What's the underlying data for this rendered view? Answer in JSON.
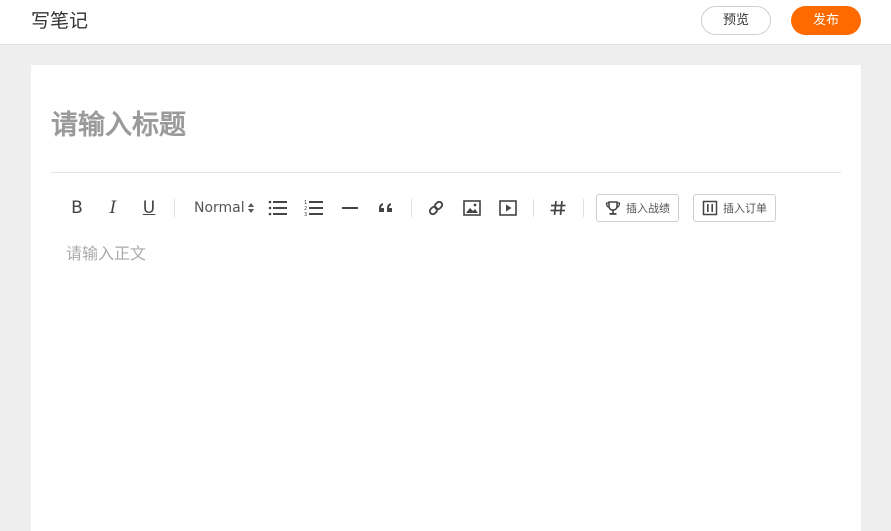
{
  "header": {
    "title": "写笔记",
    "preview_label": "预览",
    "publish_label": "发布"
  },
  "editor": {
    "title_placeholder": "请输入标题",
    "body_placeholder": "请输入正文"
  },
  "toolbar": {
    "bold": "B",
    "italic": "I",
    "underline": "U",
    "header_select_value": "Normal",
    "insert_achievement_label": "插入战绩",
    "insert_order_label": "插入订单"
  },
  "colors": {
    "accent": "#ff6a00",
    "background": "#eeeeee",
    "placeholder": "#999999"
  }
}
